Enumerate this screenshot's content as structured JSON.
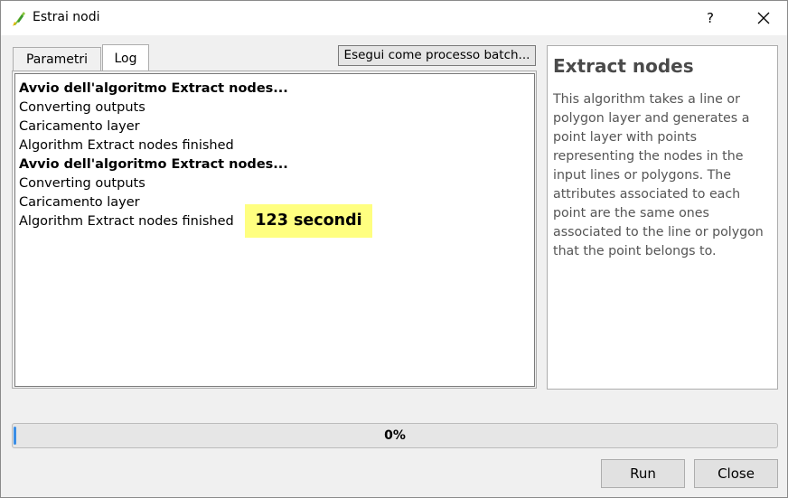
{
  "window": {
    "title": "Estrai nodi",
    "help_label": "?"
  },
  "tabs": [
    {
      "label": "Parametri",
      "active": false
    },
    {
      "label": "Log",
      "active": true
    }
  ],
  "toolbar": {
    "batch_label": "Esegui come processo batch..."
  },
  "log": {
    "lines": [
      {
        "text": "Avvio dell'algoritmo Extract nodes...",
        "bold": true
      },
      {
        "text": "Converting outputs",
        "bold": false
      },
      {
        "text": "Caricamento layer",
        "bold": false
      },
      {
        "text": "Algorithm Extract nodes finished",
        "bold": false
      },
      {
        "text": "Avvio dell'algoritmo Extract nodes...",
        "bold": true
      },
      {
        "text": "Converting outputs",
        "bold": false
      },
      {
        "text": "Caricamento layer",
        "bold": false
      },
      {
        "text": "Algorithm Extract nodes finished",
        "bold": false
      }
    ],
    "highlight": "123 secondi",
    "highlight_color": "#ffff80"
  },
  "help": {
    "title": "Extract nodes",
    "description": "This algorithm takes a line or polygon layer and generates a point layer with points representing the nodes in the input lines or polygons. The attributes associated to each point are the same ones associated to the line or polygon that the point belongs to."
  },
  "progress": {
    "value": 0,
    "label": "0%",
    "color": "#3a8ee6"
  },
  "buttons": {
    "run_label": "Run",
    "close_label": "Close"
  }
}
